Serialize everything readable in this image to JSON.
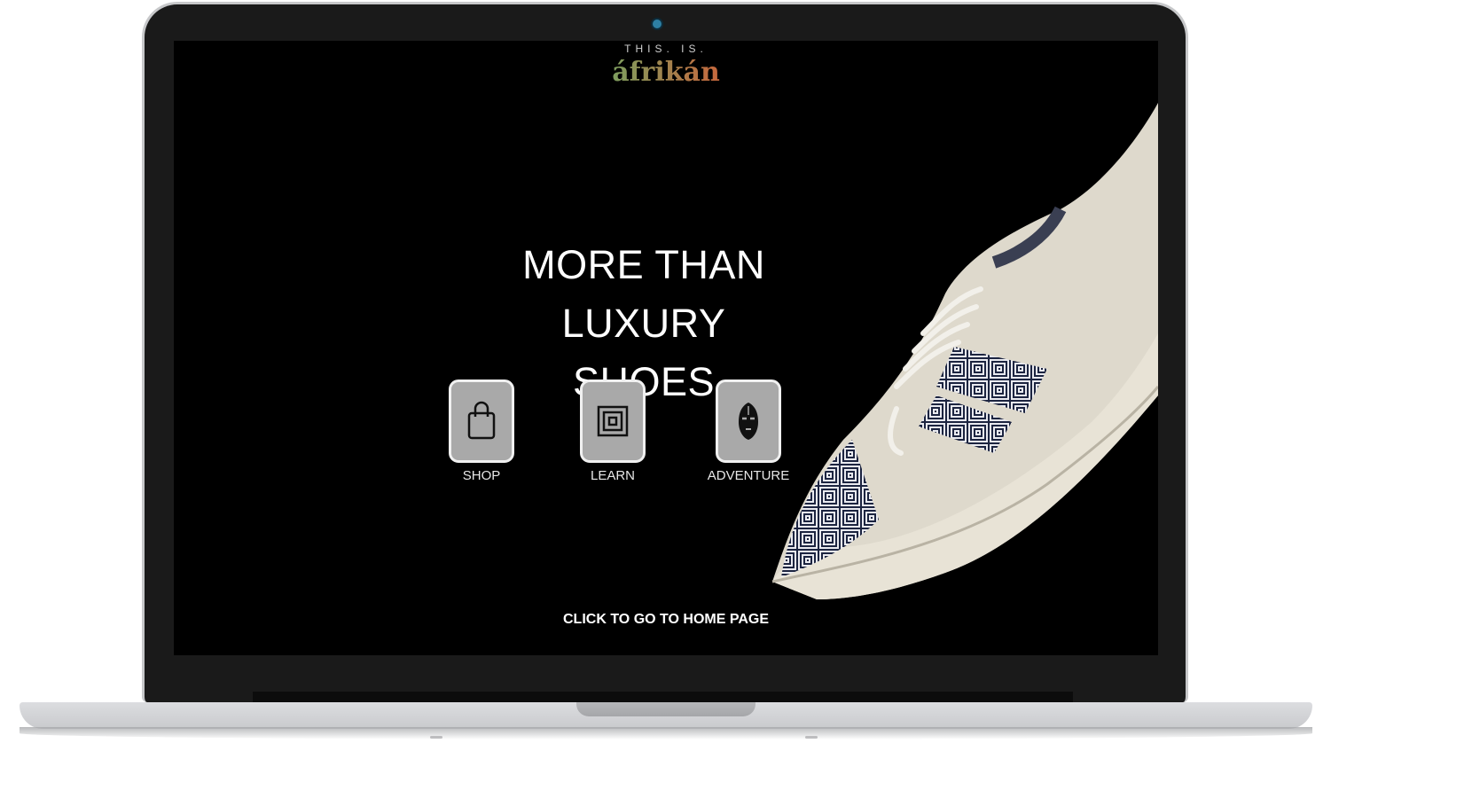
{
  "brand": {
    "tagline": "THIS. IS.",
    "name": "áfrikán"
  },
  "hero": {
    "headline_line1": "MORE THAN LUXURY",
    "headline_line2": "SHOES"
  },
  "nav": [
    {
      "label": "SHOP",
      "icon": "shopping-bag-icon"
    },
    {
      "label": "LEARN",
      "icon": "square-spiral-icon"
    },
    {
      "label": "ADVENTURE",
      "icon": "tribal-mask-icon"
    }
  ],
  "footer": {
    "home_link": "CLICK TO GO TO HOME PAGE"
  },
  "colors": {
    "background": "#000000",
    "tile": "#a9a9a9",
    "text": "#ffffff"
  }
}
